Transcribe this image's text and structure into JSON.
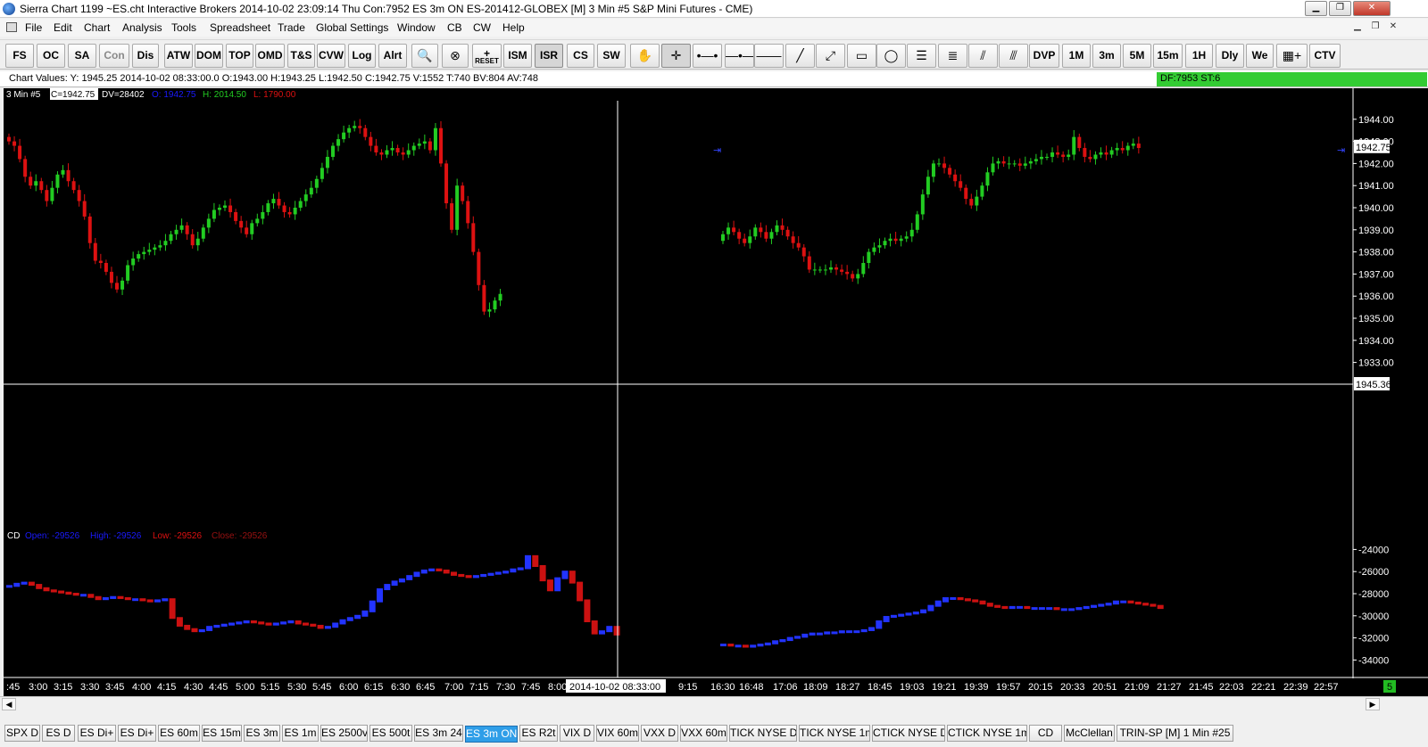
{
  "window": {
    "title": "Sierra Chart 1199 ~ES.cht  Interactive Brokers 2014-10-02  23:09:14 Thu  Con:7952  ES 3m ON  ES-201412-GLOBEX [M]  3 Min  #5  S&P Mini Futures - CME)",
    "minimize": "▁",
    "restore": "❐",
    "close": "✕"
  },
  "menu": {
    "items": [
      "File",
      "Edit",
      "Chart",
      "Analysis",
      "Tools",
      "Spreadsheet",
      "Trade",
      "Global Settings",
      "Window",
      "CB",
      "CW",
      "Help"
    ]
  },
  "toolbar": {
    "buttons": [
      {
        "label": "FS"
      },
      {
        "label": "OC"
      },
      {
        "label": "SA"
      },
      {
        "label": "Con",
        "dim": true
      },
      {
        "label": "Dis"
      },
      {
        "label": "ATW"
      },
      {
        "label": "DOM"
      },
      {
        "label": "TOP"
      },
      {
        "label": "OMD"
      },
      {
        "label": "T&S"
      },
      {
        "label": "CVW"
      },
      {
        "label": "Log"
      },
      {
        "label": "Alrt"
      },
      {
        "label": "🔍",
        "icon": true
      },
      {
        "label": "⊗",
        "icon": true
      },
      {
        "label": "+",
        "sub": "RESET"
      },
      {
        "label": "ISM"
      },
      {
        "label": "ISR",
        "pressed": true
      },
      {
        "label": "CS"
      },
      {
        "label": "SW"
      },
      {
        "label": "✋",
        "icon": true
      },
      {
        "label": "✛",
        "icon": true
      },
      {
        "label": "•—•",
        "icon": true
      },
      {
        "label": "—•—",
        "icon": true
      },
      {
        "label": "——",
        "icon": true
      },
      {
        "label": "╱",
        "icon": true
      },
      {
        "label": "⤢",
        "icon": true
      },
      {
        "label": "▭",
        "icon": true
      },
      {
        "label": "◯",
        "icon": true
      },
      {
        "label": "☰",
        "icon": true
      },
      {
        "label": "≣",
        "icon": true
      },
      {
        "label": "⫽",
        "icon": true
      },
      {
        "label": "⫻",
        "icon": true
      },
      {
        "label": "DVP"
      },
      {
        "label": "1M"
      },
      {
        "label": "3m"
      },
      {
        "label": "5M"
      },
      {
        "label": "15m"
      },
      {
        "label": "1H"
      },
      {
        "label": "Dly"
      },
      {
        "label": "We"
      },
      {
        "label": "▦+",
        "icon": true
      },
      {
        "label": "CTV"
      }
    ]
  },
  "chart_values": {
    "text": "Chart Values: Y: 1945.25  2014-10-02  08:33:00.0   O:1943.00   H:1943.25   L:1942.50   C:1942.75   V:1552   T:740   BV:804   AV:748",
    "df": "DF:7953   ST:6"
  },
  "price_header": {
    "label": "3 Min  #5",
    "c": "C=1942.75",
    "dv": "DV=28402",
    "o": "O: 1942.75",
    "h": "H: 2014.50",
    "l": "L: 1790.00"
  },
  "cd_header": {
    "label": "CD",
    "open": "Open: -29526",
    "high": "High: -29526",
    "low": "Low: -29526",
    "close": "Close: -29526"
  },
  "colors": {
    "up": "#22cc22",
    "down": "#dd1111",
    "cd_up": "#2233ff",
    "cd_down": "#cc1111"
  },
  "chart_data": [
    {
      "type": "candlestick",
      "series": [
        {
          "name": "ES-201412-GLOBEX [M] 3 Min"
        }
      ],
      "ylim": [
        1932.5,
        1945.0
      ],
      "y_ticks": [
        1944,
        1943,
        1942,
        1941,
        1940,
        1939,
        1938,
        1937,
        1936,
        1935,
        1934,
        1933
      ],
      "y_tick_labels": [
        "1944.00",
        "1943.00",
        "1942.00",
        "1941.00",
        "1940.00",
        "1939.00",
        "1938.00",
        "1937.00",
        "1936.00",
        "1935.00",
        "1934.00",
        "1933.00"
      ],
      "last_price_label": "1942.75",
      "crosshair_label": "1945.36",
      "close_path": [
        1943,
        1942.8,
        1942.2,
        1941.4,
        1941,
        1941.2,
        1940.8,
        1940.3,
        1940.9,
        1941.5,
        1941.7,
        1941.2,
        1940.8,
        1940.3,
        1939.6,
        1938.4,
        1937.6,
        1937.5,
        1937.1,
        1936.6,
        1936.3,
        1936.7,
        1937.4,
        1937.7,
        1937.9,
        1938,
        1938.1,
        1938.2,
        1938.3,
        1938.5,
        1938.8,
        1939,
        1939.2,
        1938.8,
        1938.3,
        1938.6,
        1939.1,
        1939.5,
        1939.9,
        1940,
        1940.1,
        1939.8,
        1939.4,
        1939.1,
        1938.8,
        1939.3,
        1939.5,
        1939.8,
        1940.2,
        1940.4,
        1940.1,
        1939.8,
        1939.7,
        1940,
        1940.3,
        1940.6,
        1940.9,
        1941.3,
        1941.8,
        1942.3,
        1942.8,
        1943.1,
        1943.4,
        1943.6,
        1943.7,
        1943.6,
        1943.2,
        1942.8,
        1942.5,
        1942.4,
        1942.6,
        1942.7,
        1942.5,
        1942.4,
        1942.6,
        1942.8,
        1942.9,
        1943,
        1942.6,
        1943.6,
        1942,
        1940.2,
        1939,
        1941,
        1940.3,
        1939.3,
        1938,
        1936.5,
        1935.3,
        1935.4,
        1935.8,
        1936.1
      ],
      "close_path_after_gap": [
        1938.8,
        1939.1,
        1938.9,
        1938.6,
        1938.4,
        1938.7,
        1939.1,
        1938.9,
        1938.6,
        1938.9,
        1939.2,
        1939,
        1938.7,
        1938.4,
        1938.2,
        1937.8,
        1937.2,
        1937.2,
        1937.2,
        1937.2,
        1937.3,
        1937.2,
        1937.1,
        1937,
        1936.8,
        1937,
        1937.5,
        1938,
        1938.2,
        1938.3,
        1938.5,
        1938.6,
        1938.5,
        1938.6,
        1938.7,
        1939,
        1939.7,
        1940.6,
        1941.4,
        1942,
        1942,
        1941.8,
        1941.5,
        1941.2,
        1940.9,
        1940.4,
        1940.1,
        1940.5,
        1941,
        1941.6,
        1942,
        1942.1,
        1942,
        1942,
        1942,
        1941.9,
        1942,
        1942.1,
        1942.2,
        1942.3,
        1942.3,
        1942.5,
        1942.4,
        1942.3,
        1942.4,
        1943.2,
        1942.7,
        1942.3,
        1942.2,
        1942.4,
        1942.5,
        1942.4,
        1942.6,
        1942.7,
        1942.6,
        1942.8,
        1942.9,
        1942.7
      ]
    },
    {
      "type": "line",
      "series": [
        {
          "name": "CD"
        }
      ],
      "ylim": [
        -35500,
        -23000
      ],
      "y_ticks": [
        -24000,
        -26000,
        -28000,
        -30000,
        -32000,
        -34000
      ],
      "y_tick_labels": [
        "-24000",
        "-26000",
        "-28000",
        "-30000",
        "-32000",
        "-34000"
      ],
      "values_before_gap": [
        -27300,
        -27100,
        -27000,
        -27200,
        -27500,
        -27700,
        -27800,
        -27900,
        -28000,
        -28100,
        -28100,
        -28300,
        -28500,
        -28400,
        -28300,
        -28400,
        -28500,
        -28500,
        -28600,
        -28700,
        -28600,
        -28500,
        -30200,
        -30900,
        -31200,
        -31400,
        -31300,
        -31000,
        -30900,
        -30800,
        -30700,
        -30600,
        -30500,
        -30600,
        -30700,
        -30800,
        -30700,
        -30600,
        -30500,
        -30700,
        -30800,
        -30900,
        -31100,
        -31000,
        -30700,
        -30400,
        -30200,
        -30000,
        -29600,
        -28700,
        -27600,
        -27200,
        -26900,
        -26700,
        -26400,
        -26100,
        -25900,
        -25800,
        -25900,
        -26100,
        -26300,
        -26400,
        -26500,
        -26400,
        -26300,
        -26200,
        -26100,
        -26000,
        -25800,
        -25700,
        -24600,
        -25500,
        -26800,
        -27700,
        -26600,
        -26000,
        -27000,
        -28600,
        -30500,
        -31600,
        -31400,
        -31000,
        -31700
      ],
      "values_after_gap": [
        -32600,
        -32700,
        -32700,
        -32800,
        -32700,
        -32600,
        -32500,
        -32300,
        -32200,
        -32000,
        -31900,
        -31700,
        -31600,
        -31600,
        -31500,
        -31500,
        -31400,
        -31400,
        -31400,
        -31300,
        -31100,
        -30500,
        -30100,
        -30000,
        -29900,
        -29800,
        -29700,
        -29500,
        -29100,
        -28700,
        -28400,
        -28400,
        -28500,
        -28600,
        -28700,
        -28900,
        -29100,
        -29200,
        -29300,
        -29200,
        -29200,
        -29300,
        -29300,
        -29300,
        -29300,
        -29400,
        -29400,
        -29400,
        -29300,
        -29200,
        -29100,
        -29000,
        -28900,
        -28700,
        -28700,
        -28800,
        -28900,
        -29000,
        -29100,
        -29300
      ]
    }
  ],
  "time_axis": {
    "labels": [
      ":45",
      "3:00",
      "3:15",
      "3:30",
      "3:45",
      "4:00",
      "4:15",
      "4:30",
      "4:45",
      "5:00",
      "5:15",
      "5:30",
      "5:45",
      "6:00",
      "6:15",
      "6:30",
      "6:45",
      "7:00",
      "7:15",
      "7:30",
      "7:45",
      "8:00",
      "9:15",
      "16:30",
      "16:48",
      "17:06",
      "18:09",
      "18:27",
      "18:45",
      "19:03",
      "19:21",
      "19:39",
      "19:57",
      "20:15",
      "20:33",
      "20:51",
      "21:09",
      "21:27",
      "21:45",
      "22:03",
      "22:21",
      "22:39",
      "22:57"
    ],
    "crosshair_time": "2014-10-02  08:33:00",
    "badge": "5"
  },
  "tabs": [
    {
      "label": "SPX D"
    },
    {
      "label": "ES D"
    },
    {
      "label": "ES Di+"
    },
    {
      "label": "ES Di+"
    },
    {
      "label": "ES 60m"
    },
    {
      "label": "ES 15m"
    },
    {
      "label": "ES 3m"
    },
    {
      "label": "ES 1m"
    },
    {
      "label": "ES 2500v"
    },
    {
      "label": "ES 500t"
    },
    {
      "label": "ES 3m 24"
    },
    {
      "label": "ES 3m ON",
      "active": true
    },
    {
      "label": "ES R2t"
    },
    {
      "label": "VIX D"
    },
    {
      "label": "VIX 60m"
    },
    {
      "label": "VXX D"
    },
    {
      "label": "VXX 60m"
    },
    {
      "label": "TICK NYSE D"
    },
    {
      "label": "TICK NYSE 1m"
    },
    {
      "label": "CTICK NYSE D"
    },
    {
      "label": "CTICK NYSE 1m"
    },
    {
      "label": "CD"
    },
    {
      "label": "McClellan"
    },
    {
      "label": "TRIN-SP [M]  1 Min   #25"
    }
  ]
}
